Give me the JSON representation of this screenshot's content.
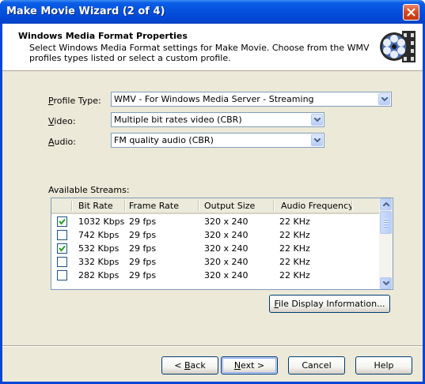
{
  "window": {
    "title": "Make Movie Wizard (2 of 4)"
  },
  "header": {
    "title": "Windows Media Format Properties",
    "description": "Select Windows Media Format settings for Make Movie. Choose from the WMV profiles types listed or select a custom profile."
  },
  "form": {
    "profile_type": {
      "label_u": "P",
      "label_rest": "rofile Type:",
      "value": "WMV - For Windows Media Server - Streaming"
    },
    "video": {
      "label_u": "V",
      "label_rest": "ideo:",
      "value": "Multiple bit rates video (CBR)"
    },
    "audio": {
      "label_u": "A",
      "label_rest": "udio:",
      "value": "FM quality audio (CBR)"
    }
  },
  "streams": {
    "label": "Available Streams:",
    "columns": [
      "Bit Rate",
      "Frame Rate",
      "Output Size",
      "Audio Frequency"
    ],
    "rows": [
      {
        "checked": true,
        "bit_rate": "1032 Kbps",
        "frame_rate": "29 fps",
        "output_size": "320 x 240",
        "audio_freq": "22 KHz"
      },
      {
        "checked": false,
        "bit_rate": "742 Kbps",
        "frame_rate": "29 fps",
        "output_size": "320 x 240",
        "audio_freq": "22 KHz"
      },
      {
        "checked": true,
        "bit_rate": "532 Kbps",
        "frame_rate": "29 fps",
        "output_size": "320 x 240",
        "audio_freq": "22 KHz"
      },
      {
        "checked": false,
        "bit_rate": "332 Kbps",
        "frame_rate": "29 fps",
        "output_size": "320 x 240",
        "audio_freq": "22 KHz"
      },
      {
        "checked": false,
        "bit_rate": "282 Kbps",
        "frame_rate": "29 fps",
        "output_size": "320 x 240",
        "audio_freq": "22 KHz"
      }
    ]
  },
  "file_display_button": {
    "u": "F",
    "rest": "ile Display Information..."
  },
  "buttons": {
    "back": {
      "pre": "< ",
      "u": "B",
      "rest": "ack"
    },
    "next": {
      "u": "N",
      "rest": "ext >"
    },
    "cancel": "Cancel",
    "help": "Help"
  },
  "colors": {
    "titlebar": "#0553e0",
    "dialog_bg": "#ece9d8",
    "checkmark": "#21a121"
  }
}
